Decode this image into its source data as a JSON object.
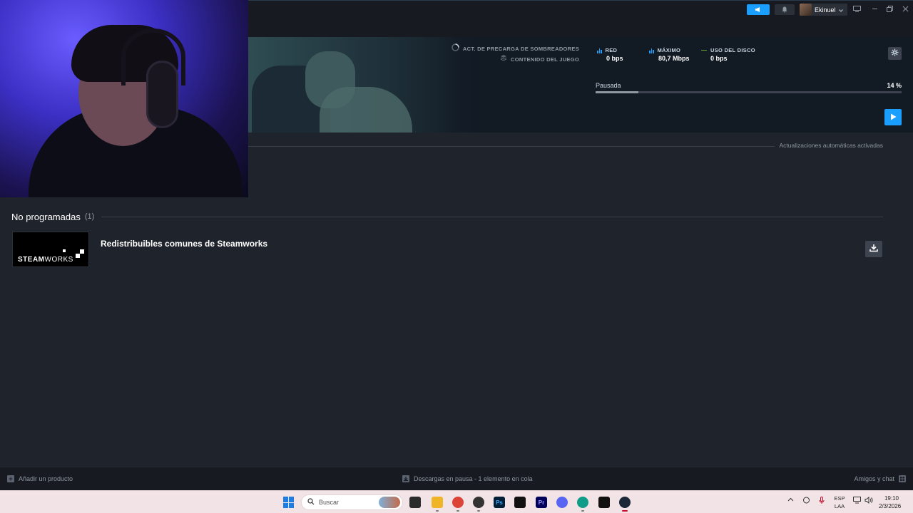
{
  "titlebar": {
    "username": "Ekinuel"
  },
  "banner": {
    "status_lines": [
      "ACT. DE PRECARGA DE SOMBREADORES",
      "CONTENIDO DEL JUEGO"
    ],
    "stats": [
      {
        "label": "RED",
        "value": "0 bps"
      },
      {
        "label": "MÁXIMO",
        "value": "80,7 Mbps"
      },
      {
        "label": "USO DEL DISCO",
        "value": "0 bps"
      }
    ],
    "progress_label": "Pausada",
    "progress_pct_text": "14 %",
    "progress_value": 0.14
  },
  "content": {
    "auto_updates": "Actualizaciones automáticas activadas",
    "section_title": "No programadas",
    "section_count": "(1)",
    "item": {
      "title": "Redistribuibles comunes de Steamworks",
      "thumb_text_bold": "STEAM",
      "thumb_text_light": "WORKS"
    }
  },
  "footer": {
    "add_product": "Añadir un producto",
    "status": "Descargas en pausa - 1 elemento en cola",
    "friends": "Amigos y chat"
  },
  "taskbar": {
    "search_placeholder": "Buscar",
    "lang_line1": "ESP",
    "lang_line2": "LAA",
    "time": "19:10",
    "date": "2/3/2026"
  },
  "colors": {
    "accent": "#1a9fff",
    "background": "#1f232b",
    "disk_green": "#5ba32b"
  },
  "icons": [
    "megaphone-icon",
    "bell-icon",
    "monitor-icon",
    "minimize-icon",
    "maximize-icon",
    "close-icon",
    "gear-icon",
    "play-icon",
    "download-icon",
    "plus-icon",
    "chat-icon",
    "windows-start-icon",
    "search-icon"
  ]
}
